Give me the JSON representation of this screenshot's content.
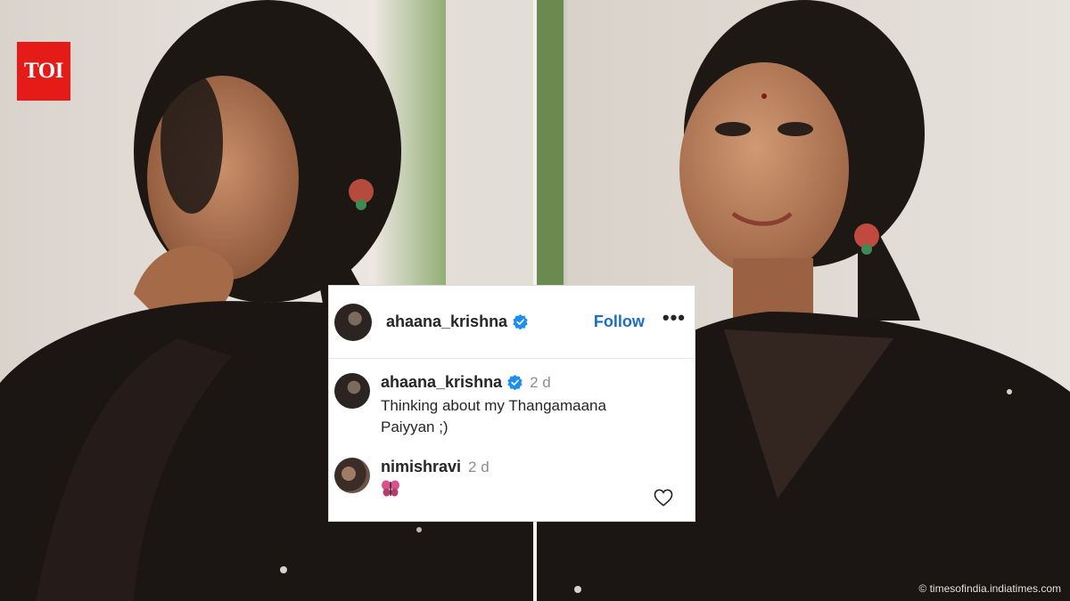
{
  "brand": {
    "logo_text": "TOI",
    "logo_color": "#e41b17"
  },
  "post": {
    "username": "ahaana_krishna",
    "follow_label": "Follow",
    "more_label": "•••",
    "accent_color": "#1b6fc2"
  },
  "comments": [
    {
      "username": "ahaana_krishna",
      "time": "2 d",
      "text": "Thinking about my Thangamaana Paiyyan ;)",
      "verified": true
    },
    {
      "username": "nimishravi",
      "time": "2 d",
      "emoji": "butterfly-icon",
      "verified": false
    }
  ],
  "watermark": "© timesofindia.indiatimes.com"
}
